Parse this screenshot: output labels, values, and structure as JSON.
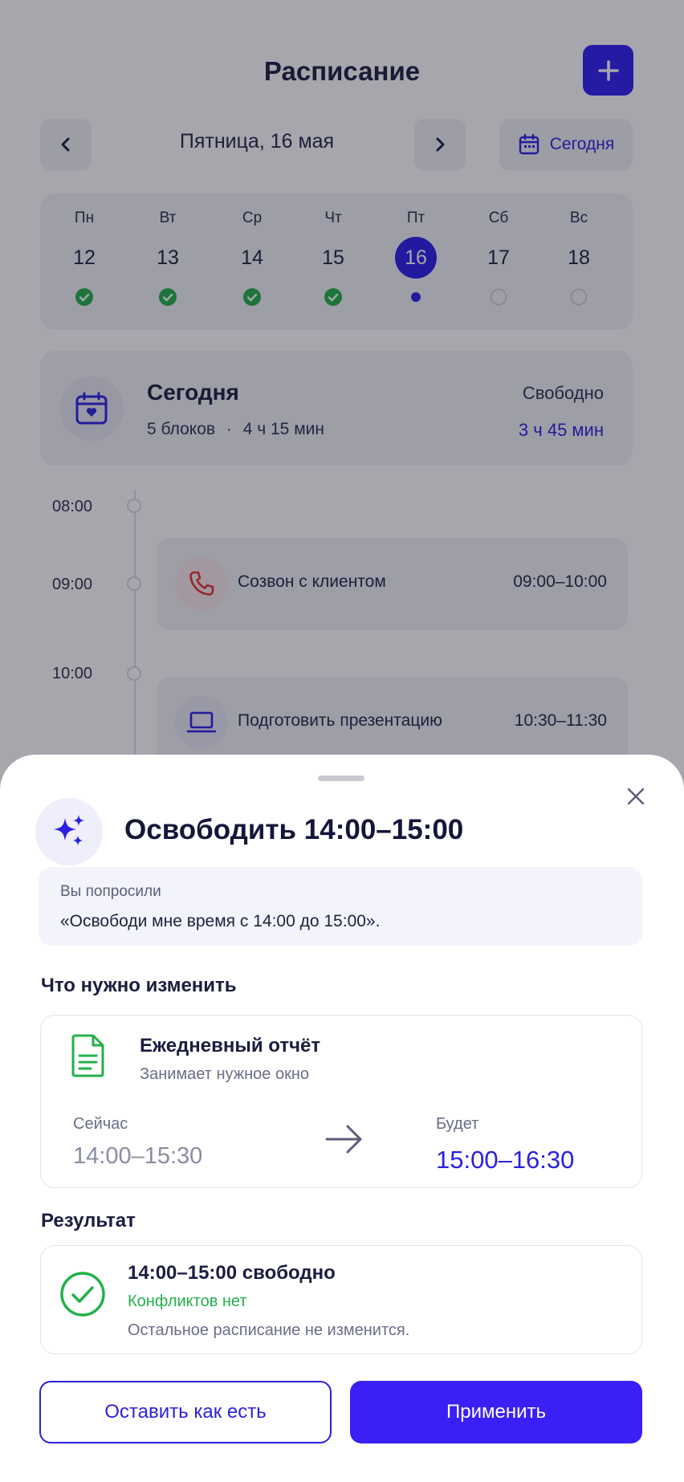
{
  "header": {
    "title": "Расписание",
    "add_icon": "plus-icon"
  },
  "datebar": {
    "date_label": "Пятница, 16 мая",
    "today_label": "Сегодня"
  },
  "week": [
    {
      "dn": "Пн",
      "num": "12",
      "status": "done"
    },
    {
      "dn": "Вт",
      "num": "13",
      "status": "done"
    },
    {
      "dn": "Ср",
      "num": "14",
      "status": "done"
    },
    {
      "dn": "Чт",
      "num": "15",
      "status": "done"
    },
    {
      "dn": "Пт",
      "num": "16",
      "status": "current"
    },
    {
      "dn": "Сб",
      "num": "17",
      "status": "empty"
    },
    {
      "dn": "Вс",
      "num": "18",
      "status": "empty"
    }
  ],
  "summary": {
    "title": "Сегодня",
    "blocks": "5 блоков",
    "separator": "·",
    "duration": "4 ч 15 мин",
    "free_label": "Свободно",
    "free_value": "3 ч 45 мин"
  },
  "timeline": {
    "times": [
      "08:00",
      "09:00",
      "10:00"
    ],
    "events": [
      {
        "title": "Созвон с клиентом",
        "time": "09:00–10:00",
        "icon": "phone-icon"
      },
      {
        "title": "Подготовить презентацию",
        "time": "10:30–11:30",
        "icon": "laptop-icon"
      }
    ]
  },
  "sheet": {
    "title": "Освободить 14:00–15:00",
    "request_label": "Вы попросили",
    "request_text": "«Освободи мне время с 14:00 до 15:00».",
    "changes_heading": "Что нужно изменить",
    "change": {
      "title": "Ежедневный отчёт",
      "subtitle": "Занимает нужное окно",
      "now_label": "Сейчас",
      "now_value": "14:00–15:30",
      "will_label": "Будет",
      "will_value": "15:00–16:30"
    },
    "result_heading": "Результат",
    "result": {
      "title": "14:00–15:00 свободно",
      "status": "Конфликтов нет",
      "note": "Остальное расписание не изменится."
    },
    "keep_label": "Оставить как есть",
    "apply_label": "Применить"
  },
  "colors": {
    "accent": "#2b21e0",
    "success": "#23b14a",
    "danger": "#e0343a"
  }
}
